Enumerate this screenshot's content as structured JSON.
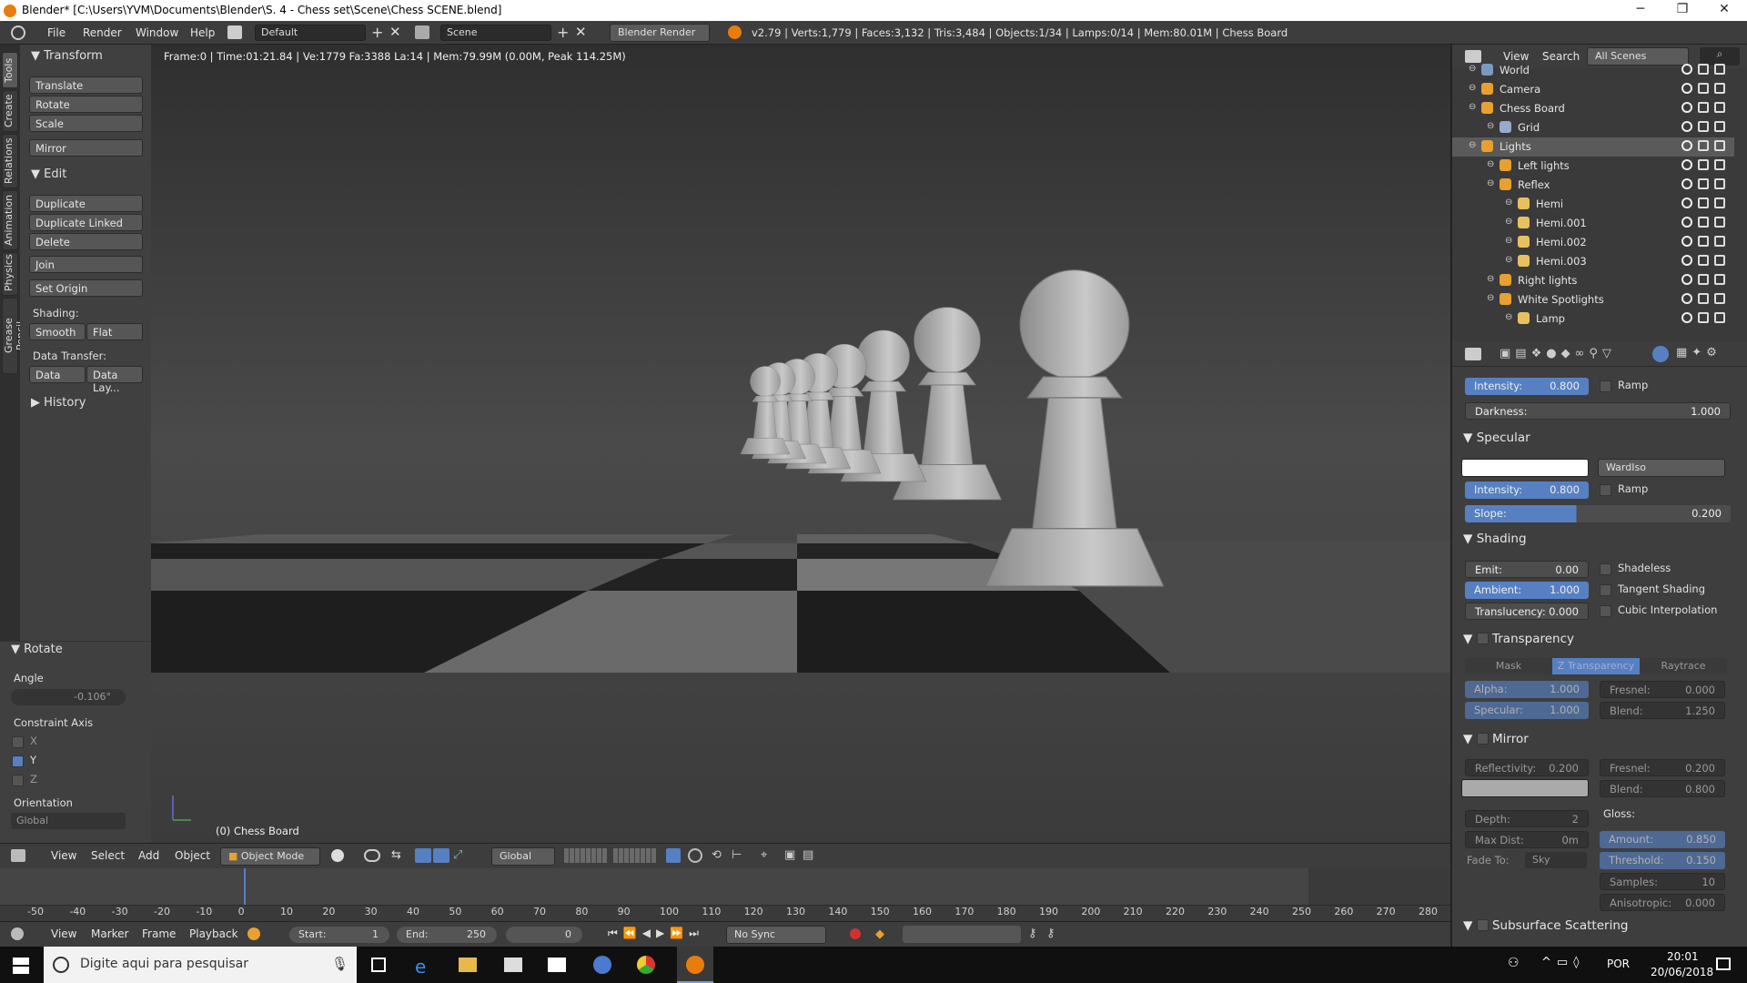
{
  "window": {
    "title": "Blender* [C:\\Users\\YVM\\Documents\\Blender\\S. 4 - Chess set\\Scene\\Chess SCENE.blend]"
  },
  "menu": [
    "File",
    "Render",
    "Window",
    "Help"
  ],
  "top": {
    "layout": "Default",
    "scene": "Scene",
    "engine": "Blender Render",
    "stats": "v2.79 | Verts:1,779 | Faces:3,132 | Tris:3,484 | Objects:1/34 | Lamps:0/14 | Mem:80.01M | Chess Board"
  },
  "left_tabs": [
    "Tools",
    "Create",
    "Relations",
    "Animation",
    "Physics",
    "Grease Pencil"
  ],
  "tools": {
    "transform_header": "Transform",
    "translate": "Translate",
    "rotate": "Rotate",
    "scale": "Scale",
    "mirror": "Mirror",
    "edit_header": "Edit",
    "duplicate": "Duplicate",
    "duplicate_linked": "Duplicate Linked",
    "delete": "Delete",
    "join": "Join",
    "set_origin": "Set Origin",
    "shading_label": "Shading:",
    "smooth": "Smooth",
    "flat": "Flat",
    "data_transfer_label": "Data Transfer:",
    "data": "Data",
    "data_lay": "Data Lay...",
    "history": "History"
  },
  "operator": {
    "title": "Rotate",
    "angle_label": "Angle",
    "angle": "-0.106°",
    "constraint_label": "Constraint Axis",
    "x": "X",
    "y": "Y",
    "z": "Z",
    "orientation_label": "Orientation",
    "orientation": "Global"
  },
  "viewport": {
    "info": "Frame:0 | Time:01:21.84 | Ve:1779 Fa:3388 La:14 | Mem:79.99M (0.00M, Peak 114.25M)",
    "object": "(0) Chess Board"
  },
  "viewheader": {
    "view": "View",
    "select": "Select",
    "add": "Add",
    "object": "Object",
    "mode": "Object Mode",
    "orient": "Global"
  },
  "timeline": {
    "ticks": [
      "-50",
      "-40",
      "-30",
      "-20",
      "-10",
      "0",
      "10",
      "20",
      "30",
      "40",
      "50",
      "60",
      "70",
      "80",
      "90",
      "100",
      "110",
      "120",
      "130",
      "140",
      "150",
      "160",
      "170",
      "180",
      "190",
      "200",
      "210",
      "220",
      "230",
      "240",
      "250",
      "260",
      "270",
      "280"
    ],
    "view": "View",
    "marker": "Marker",
    "frame": "Frame",
    "playback": "Playback",
    "start_label": "Start:",
    "start": "1",
    "end_label": "End:",
    "end": "250",
    "current": "0",
    "sync": "No Sync"
  },
  "outliner": {
    "view": "View",
    "search": "Search",
    "scenes": "All Scenes",
    "rows": [
      "World",
      "Camera",
      "Chess Board",
      "Grid",
      "Lights",
      "Left lights",
      "Reflex",
      "Hemi",
      "Hemi.001",
      "Hemi.002",
      "Hemi.003",
      "Right lights",
      "White Spotlights",
      "Lamp"
    ]
  },
  "props": {
    "intensity_label": "Intensity:",
    "intensity": "0.800",
    "ramp": "Ramp",
    "darkness_label": "Darkness:",
    "darkness": "1.000",
    "specular": "Specular",
    "wardiso": "WardIso",
    "spec_intensity": "0.800",
    "slope_label": "Slope:",
    "slope": "0.200",
    "shading": "Shading",
    "emit_label": "Emit:",
    "emit": "0.00",
    "shadeless": "Shadeless",
    "ambient_label": "Ambient:",
    "ambient": "1.000",
    "tangent": "Tangent Shading",
    "transl_label": "Translucency:",
    "transl": "0.000",
    "cubic": "Cubic Interpolation",
    "transparency": "Transparency",
    "mask": "Mask",
    "ztrans": "Z Transparency",
    "raytrace": "Raytrace",
    "alpha_label": "Alpha:",
    "alpha": "1.000",
    "fresnel_label": "Fresnel:",
    "fresnel": "0.000",
    "spec_label": "Specular:",
    "spec": "1.000",
    "blend_label": "Blend:",
    "blend": "1.250",
    "mirror": "Mirror",
    "reflect_label": "Reflectivity:",
    "reflect": "0.200",
    "mfresnel": "0.200",
    "mblend": "0.800",
    "depth_label": "Depth:",
    "depth": "2",
    "gloss_label": "Gloss:",
    "maxdist_label": "Max Dist:",
    "maxdist": "0m",
    "amount_label": "Amount:",
    "amount": "0.850",
    "fadeto_label": "Fade To:",
    "fadeto": "Sky",
    "threshold_label": "Threshold:",
    "threshold": "0.150",
    "samples_label": "Samples:",
    "samples": "10",
    "aniso_label": "Anisotropic:",
    "aniso": "0.000",
    "sss": "Subsurface Scattering"
  },
  "taskbar": {
    "search": "Digite aqui para pesquisar",
    "lang": "POR",
    "time": "20:01",
    "date": "20/06/2018"
  }
}
